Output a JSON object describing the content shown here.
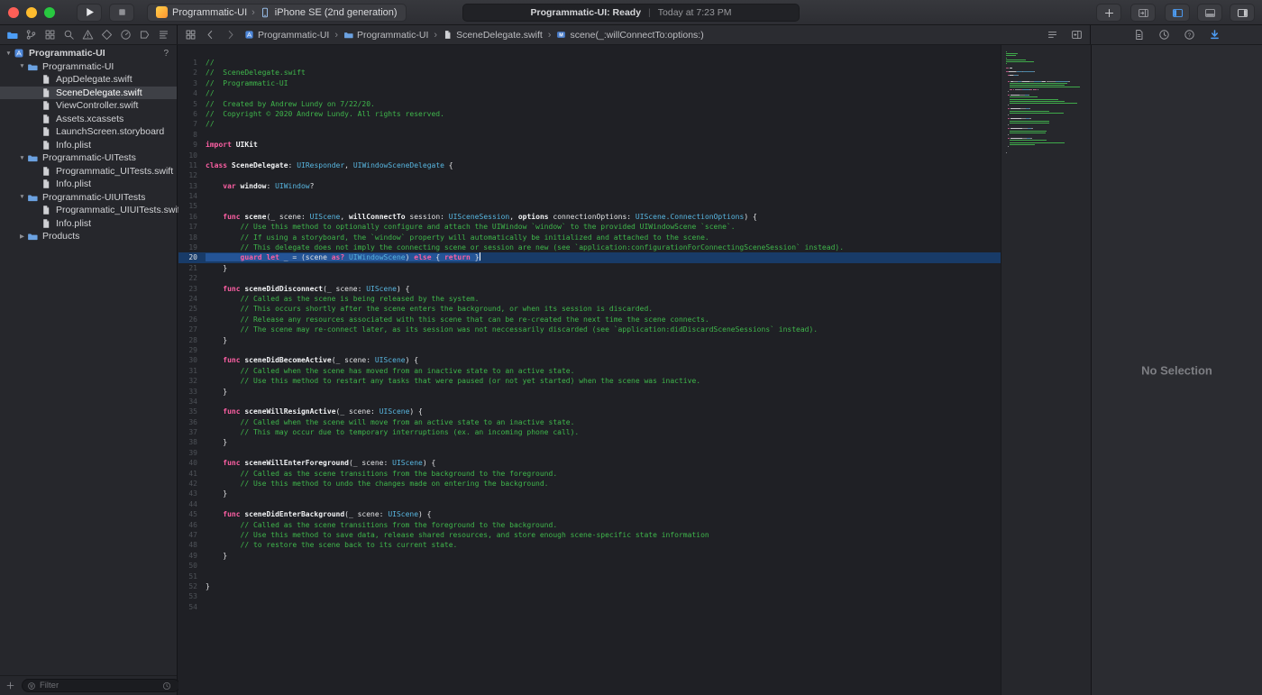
{
  "toolbar": {
    "scheme": {
      "target": "Programmatic-UI",
      "device": "iPhone SE (2nd generation)"
    },
    "status": {
      "left": "Programmatic-UI: Ready",
      "divider": "|",
      "right": "Today at 7:23 PM"
    }
  },
  "navigator_tabs": [
    {
      "name": "project-navigator",
      "icon": "folder",
      "active": true
    },
    {
      "name": "source-control-navigator",
      "icon": "branch",
      "active": false
    },
    {
      "name": "symbol-navigator",
      "icon": "grid4",
      "active": false
    },
    {
      "name": "find-navigator",
      "icon": "magnifier",
      "active": false
    },
    {
      "name": "issue-navigator",
      "icon": "warning",
      "active": false
    },
    {
      "name": "test-navigator",
      "icon": "diamond",
      "active": false
    },
    {
      "name": "debug-navigator",
      "icon": "gauge",
      "active": false
    },
    {
      "name": "breakpoint-navigator",
      "icon": "breakpoint",
      "active": false
    },
    {
      "name": "report-navigator",
      "icon": "report",
      "active": false
    }
  ],
  "breadcrumb": [
    {
      "label": "Programmatic-UI",
      "icon": "project"
    },
    {
      "label": "Programmatic-UI",
      "icon": "folder"
    },
    {
      "label": "SceneDelegate.swift",
      "icon": "swift-file"
    },
    {
      "label": "scene(_:willConnectTo:options:)",
      "icon": "mbadge",
      "badge": "M"
    }
  ],
  "sidebar": {
    "filter_placeholder": "Filter",
    "items": [
      {
        "label": "Programmatic-UI",
        "icon": "project",
        "level": 0,
        "expanded": true,
        "badge": "?",
        "bold": true
      },
      {
        "label": "Programmatic-UI",
        "icon": "folder",
        "level": 1,
        "expanded": true
      },
      {
        "label": "AppDelegate.swift",
        "icon": "swift-file",
        "level": 2
      },
      {
        "label": "SceneDelegate.swift",
        "icon": "swift-file",
        "level": 2,
        "selected": true
      },
      {
        "label": "ViewController.swift",
        "icon": "swift-file",
        "level": 2
      },
      {
        "label": "Assets.xcassets",
        "icon": "asset-file",
        "level": 2
      },
      {
        "label": "LaunchScreen.storyboard",
        "icon": "storyboard-file",
        "level": 2
      },
      {
        "label": "Info.plist",
        "icon": "plist-file",
        "level": 2
      },
      {
        "label": "Programmatic-UITests",
        "icon": "folder",
        "level": 1,
        "expanded": true
      },
      {
        "label": "Programmatic_UITests.swift",
        "icon": "swift-file",
        "level": 2
      },
      {
        "label": "Info.plist",
        "icon": "plist-file",
        "level": 2
      },
      {
        "label": "Programmatic-UIUITests",
        "icon": "folder",
        "level": 1,
        "expanded": true
      },
      {
        "label": "Programmatic_UIUITests.swift",
        "icon": "swift-file",
        "level": 2
      },
      {
        "label": "Info.plist",
        "icon": "plist-file",
        "level": 2
      },
      {
        "label": "Products",
        "icon": "folder",
        "level": 1,
        "expanded": false
      }
    ]
  },
  "inspector": {
    "no_selection": "No Selection"
  },
  "icons": {
    "play-icon": "▶",
    "stop-icon": "■",
    "plus-icon": "+",
    "chevron-right-icon": "›",
    "chevron-left-icon": "‹",
    "disclosure-open-icon": "▼",
    "disclosure-closed-icon": "▶",
    "project-badge": "?",
    "method-badge": "M"
  },
  "colors": {
    "accent": "#4d9df5",
    "syntax_comment": "#3fb64b",
    "syntax_keyword": "#fc5fa3",
    "syntax_type": "#58b6e0",
    "syntax_plain": "#e3e4e6",
    "current_line_highlight": "#173e70",
    "traffic_red": "#ff5f57",
    "traffic_yellow": "#febc2e",
    "traffic_green": "#28c840"
  },
  "editor": {
    "current_line": 20,
    "lines": [
      [
        [
          "c",
          "//"
        ]
      ],
      [
        [
          "c",
          "//  SceneDelegate.swift"
        ]
      ],
      [
        [
          "c",
          "//  Programmatic-UI"
        ]
      ],
      [
        [
          "c",
          "//"
        ]
      ],
      [
        [
          "c",
          "//  Created by Andrew Lundy on 7/22/20."
        ]
      ],
      [
        [
          "c",
          "//  Copyright © 2020 Andrew Lundy. All rights reserved."
        ]
      ],
      [
        [
          "c",
          "//"
        ]
      ],
      [],
      [
        [
          "k",
          "import"
        ],
        [
          "p",
          " "
        ],
        [
          "b",
          "UIKit"
        ]
      ],
      [],
      [
        [
          "k",
          "class"
        ],
        [
          "p",
          " "
        ],
        [
          "b",
          "SceneDelegate"
        ],
        [
          "p",
          ": "
        ],
        [
          "t",
          "UIResponder"
        ],
        [
          "p",
          ", "
        ],
        [
          "t",
          "UIWindowSceneDelegate"
        ],
        [
          "p",
          " {"
        ]
      ],
      [],
      [
        [
          "p",
          "    "
        ],
        [
          "k",
          "var"
        ],
        [
          "p",
          " "
        ],
        [
          "b",
          "window"
        ],
        [
          "p",
          ": "
        ],
        [
          "t",
          "UIWindow"
        ],
        [
          "p",
          "?"
        ]
      ],
      [],
      [],
      [
        [
          "p",
          "    "
        ],
        [
          "k",
          "func"
        ],
        [
          "p",
          " "
        ],
        [
          "b",
          "scene"
        ],
        [
          "p",
          "(_ scene: "
        ],
        [
          "t",
          "UIScene"
        ],
        [
          "p",
          ", "
        ],
        [
          "b",
          "willConnectTo"
        ],
        [
          "p",
          " session: "
        ],
        [
          "t",
          "UISceneSession"
        ],
        [
          "p",
          ", "
        ],
        [
          "b",
          "options"
        ],
        [
          "p",
          " connectionOptions: "
        ],
        [
          "t",
          "UIScene.ConnectionOptions"
        ],
        [
          "p",
          ") {"
        ]
      ],
      [
        [
          "c",
          "        // Use this method to optionally configure and attach the UIWindow `window` to the provided UIWindowScene `scene`."
        ]
      ],
      [
        [
          "c",
          "        // If using a storyboard, the `window` property will automatically be initialized and attached to the scene."
        ]
      ],
      [
        [
          "c",
          "        // This delegate does not imply the connecting scene or session are new (see `application:configurationForConnectingSceneSession` instead)."
        ]
      ],
      [
        [
          "p",
          "        "
        ],
        [
          "k",
          "guard"
        ],
        [
          "p",
          " "
        ],
        [
          "k",
          "let"
        ],
        [
          "p",
          " _ = (scene "
        ],
        [
          "k",
          "as?"
        ],
        [
          "p",
          " "
        ],
        [
          "t",
          "UIWindowScene"
        ],
        [
          "p",
          ") "
        ],
        [
          "k",
          "else"
        ],
        [
          "p",
          " { "
        ],
        [
          "k",
          "return"
        ],
        [
          "p",
          " }"
        ]
      ],
      [
        [
          "p",
          "    }"
        ]
      ],
      [],
      [
        [
          "p",
          "    "
        ],
        [
          "k",
          "func"
        ],
        [
          "p",
          " "
        ],
        [
          "b",
          "sceneDidDisconnect"
        ],
        [
          "p",
          "(_ scene: "
        ],
        [
          "t",
          "UIScene"
        ],
        [
          "p",
          ") {"
        ]
      ],
      [
        [
          "c",
          "        // Called as the scene is being released by the system."
        ]
      ],
      [
        [
          "c",
          "        // This occurs shortly after the scene enters the background, or when its session is discarded."
        ]
      ],
      [
        [
          "c",
          "        // Release any resources associated with this scene that can be re-created the next time the scene connects."
        ]
      ],
      [
        [
          "c",
          "        // The scene may re-connect later, as its session was not neccessarily discarded (see `application:didDiscardSceneSessions` instead)."
        ]
      ],
      [
        [
          "p",
          "    }"
        ]
      ],
      [],
      [
        [
          "p",
          "    "
        ],
        [
          "k",
          "func"
        ],
        [
          "p",
          " "
        ],
        [
          "b",
          "sceneDidBecomeActive"
        ],
        [
          "p",
          "(_ scene: "
        ],
        [
          "t",
          "UIScene"
        ],
        [
          "p",
          ") {"
        ]
      ],
      [
        [
          "c",
          "        // Called when the scene has moved from an inactive state to an active state."
        ]
      ],
      [
        [
          "c",
          "        // Use this method to restart any tasks that were paused (or not yet started) when the scene was inactive."
        ]
      ],
      [
        [
          "p",
          "    }"
        ]
      ],
      [],
      [
        [
          "p",
          "    "
        ],
        [
          "k",
          "func"
        ],
        [
          "p",
          " "
        ],
        [
          "b",
          "sceneWillResignActive"
        ],
        [
          "p",
          "(_ scene: "
        ],
        [
          "t",
          "UIScene"
        ],
        [
          "p",
          ") {"
        ]
      ],
      [
        [
          "c",
          "        // Called when the scene will move from an active state to an inactive state."
        ]
      ],
      [
        [
          "c",
          "        // This may occur due to temporary interruptions (ex. an incoming phone call)."
        ]
      ],
      [
        [
          "p",
          "    }"
        ]
      ],
      [],
      [
        [
          "p",
          "    "
        ],
        [
          "k",
          "func"
        ],
        [
          "p",
          " "
        ],
        [
          "b",
          "sceneWillEnterForeground"
        ],
        [
          "p",
          "(_ scene: "
        ],
        [
          "t",
          "UIScene"
        ],
        [
          "p",
          ") {"
        ]
      ],
      [
        [
          "c",
          "        // Called as the scene transitions from the background to the foreground."
        ]
      ],
      [
        [
          "c",
          "        // Use this method to undo the changes made on entering the background."
        ]
      ],
      [
        [
          "p",
          "    }"
        ]
      ],
      [],
      [
        [
          "p",
          "    "
        ],
        [
          "k",
          "func"
        ],
        [
          "p",
          " "
        ],
        [
          "b",
          "sceneDidEnterBackground"
        ],
        [
          "p",
          "(_ scene: "
        ],
        [
          "t",
          "UIScene"
        ],
        [
          "p",
          ") {"
        ]
      ],
      [
        [
          "c",
          "        // Called as the scene transitions from the foreground to the background."
        ]
      ],
      [
        [
          "c",
          "        // Use this method to save data, release shared resources, and store enough scene-specific state information"
        ]
      ],
      [
        [
          "c",
          "        // to restore the scene back to its current state."
        ]
      ],
      [
        [
          "p",
          "    }"
        ]
      ],
      [],
      [],
      [
        [
          "p",
          "}"
        ]
      ],
      [],
      []
    ]
  }
}
